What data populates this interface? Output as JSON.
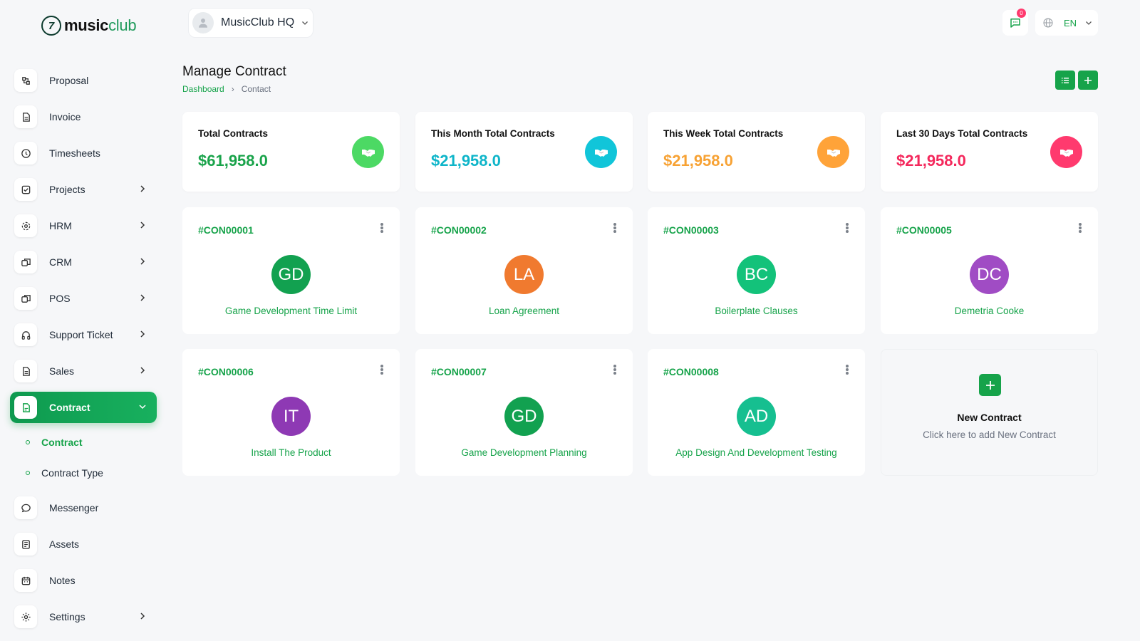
{
  "logo": {
    "mark": "7",
    "text_bold": "music",
    "text_light": "club"
  },
  "workspace": {
    "name": "MusicClub HQ"
  },
  "notifications": {
    "count": "0"
  },
  "language": {
    "code": "EN"
  },
  "sidebar": {
    "items": [
      {
        "label": "Proposal",
        "icon": "proposal-icon",
        "has_children": false
      },
      {
        "label": "Invoice",
        "icon": "invoice-icon",
        "has_children": false
      },
      {
        "label": "Timesheets",
        "icon": "clock-icon",
        "has_children": false
      },
      {
        "label": "Projects",
        "icon": "projects-icon",
        "has_children": true
      },
      {
        "label": "HRM",
        "icon": "hrm-icon",
        "has_children": true
      },
      {
        "label": "CRM",
        "icon": "crm-icon",
        "has_children": true
      },
      {
        "label": "POS",
        "icon": "pos-icon",
        "has_children": true
      },
      {
        "label": "Support Ticket",
        "icon": "headphones-icon",
        "has_children": true
      },
      {
        "label": "Sales",
        "icon": "sales-icon",
        "has_children": true
      },
      {
        "label": "Contract",
        "icon": "contract-icon",
        "has_children": true,
        "active": true
      },
      {
        "label": "Messenger",
        "icon": "chat-icon",
        "has_children": false
      },
      {
        "label": "Assets",
        "icon": "assets-icon",
        "has_children": false
      },
      {
        "label": "Notes",
        "icon": "calendar-icon",
        "has_children": false
      },
      {
        "label": "Settings",
        "icon": "gear-icon",
        "has_children": true
      }
    ],
    "contract_sub": [
      {
        "label": "Contract",
        "current": true
      },
      {
        "label": "Contract Type",
        "current": false
      }
    ]
  },
  "page": {
    "title": "Manage Contract",
    "breadcrumb": {
      "home": "Dashboard",
      "separator": "›",
      "current": "Contact"
    }
  },
  "stats": [
    {
      "label": "Total Contracts",
      "value": "$61,958.0",
      "color": "#19a34a",
      "icon_bg": "#4cd964"
    },
    {
      "label": "This Month Total Contracts",
      "value": "$21,958.0",
      "color": "#0eb5c9",
      "icon_bg": "#11c5d9"
    },
    {
      "label": "This Week Total Contracts",
      "value": "$21,958.0",
      "color": "#f7a234",
      "icon_bg": "#ffa339"
    },
    {
      "label": "Last 30 Days Total Contracts",
      "value": "$21,958.0",
      "color": "#f4285c",
      "icon_bg": "#ff3a6e"
    }
  ],
  "contracts": [
    {
      "id": "#CON00001",
      "initials": "GD",
      "name": "Game Development Time Limit",
      "color": "#12a150"
    },
    {
      "id": "#CON00002",
      "initials": "LA",
      "name": "Loan Agreement",
      "color": "#f07a2f"
    },
    {
      "id": "#CON00003",
      "initials": "BC",
      "name": "Boilerplate Clauses",
      "color": "#13c27a"
    },
    {
      "id": "#CON00005",
      "initials": "DC",
      "name": "Demetria Cooke",
      "color": "#a04cc4"
    },
    {
      "id": "#CON00006",
      "initials": "IT",
      "name": "Install The Product",
      "color": "#8e39b4"
    },
    {
      "id": "#CON00007",
      "initials": "GD",
      "name": "Game Development Planning",
      "color": "#12a150"
    },
    {
      "id": "#CON00008",
      "initials": "AD",
      "name": "App Design And Development Testing",
      "color": "#16bf90"
    }
  ],
  "new_contract": {
    "title": "New Contract",
    "subtitle": "Click here to add New Contract"
  }
}
